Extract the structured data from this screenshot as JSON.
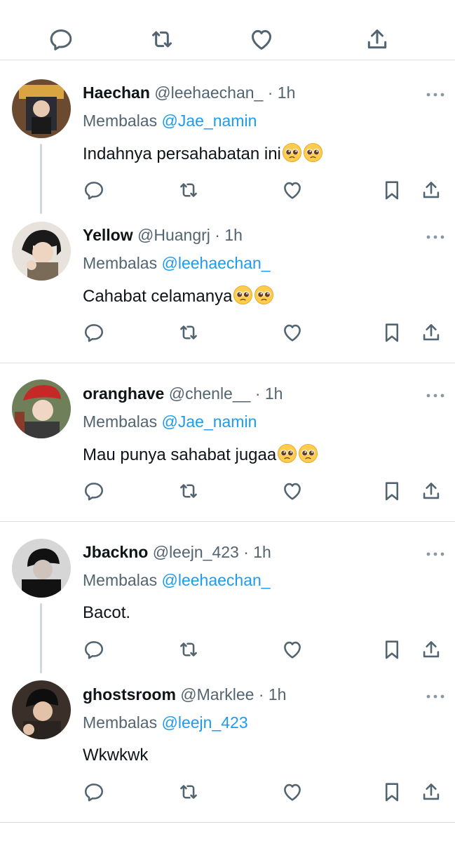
{
  "top_actions": [
    {
      "name": "reply-icon"
    },
    {
      "name": "retweet-icon"
    },
    {
      "name": "like-icon"
    },
    {
      "name": "share-icon"
    }
  ],
  "colors": {
    "link": "#1d9bf0",
    "secondary_text": "#536471",
    "primary_text": "#0f1419",
    "divider": "#d9dee2",
    "thread_line": "#cfd9de"
  },
  "tweets": [
    {
      "name": "Haechan",
      "handle": "@leehaechan_",
      "time": "· 1h",
      "reply_prefix": "Membalas",
      "reply_to": "@Jae_namin",
      "text": "Indahnya persahabatan ini",
      "emoji_count": 2,
      "emoji": "pleading-face"
    },
    {
      "name": "Yellow",
      "handle": "@Huangrj",
      "time": "· 1h",
      "reply_prefix": "Membalas",
      "reply_to": "@leehaechan_",
      "text": "Cahabat celamanya",
      "emoji_count": 2,
      "emoji": "pleading-face"
    },
    {
      "name": "oranghave",
      "handle": "@chenle__",
      "time": "· 1h",
      "reply_prefix": "Membalas",
      "reply_to": "@Jae_namin",
      "text": "Mau punya sahabat jugaa",
      "emoji_count": 2,
      "emoji": "pleading-face"
    },
    {
      "name": "Jbackno",
      "handle": "@leejn_423",
      "time": "· 1h",
      "reply_prefix": "Membalas",
      "reply_to": "@leehaechan_",
      "text": "Bacot.",
      "emoji_count": 0
    },
    {
      "name": "ghostsroom",
      "handle": "@Marklee",
      "time": "· 1h",
      "reply_prefix": "Membalas",
      "reply_to": "@leejn_423",
      "text": "Wkwkwk",
      "emoji_count": 0
    }
  ]
}
